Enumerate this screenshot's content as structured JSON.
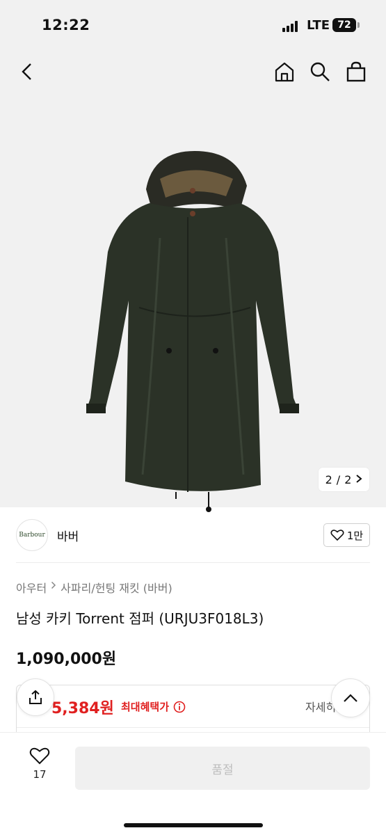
{
  "status_bar": {
    "time": "12:22",
    "network": "LTE",
    "battery": "72"
  },
  "gallery": {
    "current": "2",
    "separator": "/",
    "total": "2"
  },
  "brand": {
    "logo_text": "Barbour",
    "name": "바버",
    "likes": "1만"
  },
  "breadcrumb": [
    "아우터",
    "사파리/헌팅 재킷 (바버)"
  ],
  "product": {
    "title": "남성 카키 Torrent 점퍼 (URJU3F018L3)",
    "price": "1,090,000원"
  },
  "benefit": {
    "price": "5,384원",
    "label": "최대혜택가",
    "detail": "자세히"
  },
  "bottom_bar": {
    "wish_count": "17",
    "soldout_label": "품절"
  },
  "colors": {
    "accent_red": "#e02020",
    "coat": "#2b3227"
  },
  "icons": [
    "back-icon",
    "home-icon",
    "search-icon",
    "bag-icon",
    "heart-icon",
    "info-icon",
    "share-icon",
    "chevron-up-icon"
  ]
}
